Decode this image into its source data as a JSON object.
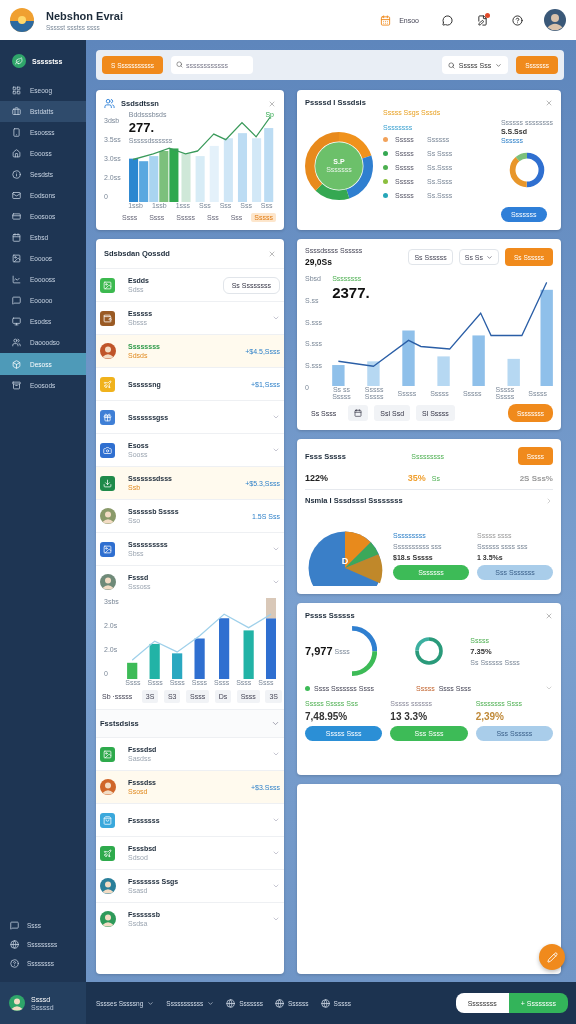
{
  "header": {
    "title": "Nebshon Evrai",
    "subtitle": "Ssssst ssstss ssss",
    "action": "Ensoo",
    "notification": true
  },
  "sidebar": {
    "brand": "Ssssstss",
    "items": [
      {
        "label": "Eseoog",
        "selected": false,
        "highlighted": false
      },
      {
        "label": "Bstdatts",
        "selected": false,
        "highlighted": true
      },
      {
        "label": "Esoosss",
        "selected": false,
        "highlighted": false
      },
      {
        "label": "Eoooss",
        "selected": false,
        "highlighted": false
      },
      {
        "label": "Sesdsts",
        "selected": false,
        "highlighted": false
      },
      {
        "label": "Eodsons",
        "selected": false,
        "highlighted": false
      },
      {
        "label": "Eoosoos",
        "selected": false,
        "highlighted": false
      },
      {
        "label": "Esbsd",
        "selected": false,
        "highlighted": false
      },
      {
        "label": "Eoooos",
        "selected": false,
        "highlighted": false
      },
      {
        "label": "Eooooss",
        "selected": false,
        "highlighted": false
      },
      {
        "label": "Eooooo",
        "selected": false,
        "highlighted": false
      },
      {
        "label": "Esodss",
        "selected": false,
        "highlighted": false
      },
      {
        "label": "Daooodso",
        "selected": false,
        "highlighted": false
      },
      {
        "label": "Desoss",
        "selected": true,
        "highlighted": false
      },
      {
        "label": "Eoosods",
        "selected": false,
        "highlighted": false
      }
    ],
    "footer_items": [
      "Ssss",
      "Sssssssss",
      "Ssssssss"
    ],
    "user": {
      "name": "Ssssd",
      "role": "Sssssd"
    }
  },
  "toolbar": {
    "primary_button": "S Sssssssssss",
    "search": {
      "placeholder": "ssssssssssss"
    },
    "filter": "Sssss Sss",
    "action_button": "Sssssss"
  },
  "summary_card": {
    "title": "Ssdsdtssn",
    "legend": "Bddsssbsds",
    "value": "277.",
    "caption": "Sssssdssssss",
    "badge": "Sp",
    "yticks": [
      "3dsb",
      "3.5ss",
      "3.0ss",
      "2.0ss",
      "0"
    ],
    "xlabels": [
      "1ssb",
      "1ssb",
      "1sss",
      "Sss",
      "Sss",
      "Sss",
      "Sss"
    ],
    "tags": [
      {
        "label": "Ssss",
        "selected": false
      },
      {
        "label": "Ssss",
        "selected": false
      },
      {
        "label": "Sssss",
        "selected": false
      },
      {
        "label": "Sss",
        "selected": false
      },
      {
        "label": "Sss",
        "selected": false
      },
      {
        "label": "Sssss",
        "selected": true
      }
    ]
  },
  "activity": {
    "title": "Sdsbsdan Qossdd",
    "rows": [
      {
        "kind": "tile",
        "color": "#3cb94f",
        "title": "Esdds",
        "subtitle": "Sdss",
        "button": "Ss Ssssssss",
        "highlighted": false
      },
      {
        "kind": "tile",
        "color": "#9a5a24",
        "title": "Esssss",
        "subtitle": "Sbsss",
        "highlighted": false
      },
      {
        "kind": "avatar",
        "color": "#c0552a",
        "title": "Ssssssss",
        "subtitle": "Sdsds",
        "amount": "+$4.5,Ssss",
        "highlighted": true
      },
      {
        "kind": "tile",
        "color": "#f0b21c",
        "title": "Ssssssng",
        "amount": "+$1,Ssss",
        "highlighted": false
      },
      {
        "kind": "tile",
        "color": "#3f7fd6",
        "title": "Sssssssgss",
        "highlighted": false
      },
      {
        "kind": "tile",
        "color": "#2f6fd0",
        "title": "Esoss",
        "subtitle": "Sooss",
        "highlighted": false
      },
      {
        "kind": "tile",
        "color": "#1f8a4a",
        "title": "Sssssssdsss",
        "subtitle": "Ssb",
        "amount": "+$5.3,Ssss",
        "highlighted": true
      },
      {
        "kind": "avatar",
        "color": "#8a9a6a",
        "title": "Ssssssb Sssss",
        "subtitle": "Sso",
        "amount": "1.5S Sss",
        "highlighted": false
      },
      {
        "kind": "tile",
        "color": "#2f6fd0",
        "title": "Ssssssssss",
        "subtitle": "Sbss",
        "highlighted": false
      },
      {
        "kind": "avatar",
        "color": "#6f8a78",
        "title": "Fsssd",
        "subtitle": "Sssoss",
        "highlighted": false
      }
    ],
    "chart": {
      "yticks": [
        "3sbs",
        "2.0s",
        "2.0s",
        "0"
      ],
      "xlabels": [
        "Ssss",
        "Ssss",
        "Ssss",
        "Ssss",
        "Ssss",
        "Ssss",
        "Ssss"
      ]
    },
    "filters": [
      {
        "label": "Sb ·sssss",
        "selected": false
      },
      {
        "label": "3S",
        "selected": true
      },
      {
        "label": "S3",
        "selected": true
      },
      {
        "label": "Ssss",
        "selected": true
      },
      {
        "label": "Ds",
        "selected": true
      },
      {
        "label": "Ssss",
        "selected": true
      },
      {
        "label": "3S",
        "selected": true
      }
    ]
  },
  "favorites": {
    "title": "Fsstsdsiss",
    "rows": [
      {
        "kind": "tile",
        "color": "#2eaa4c",
        "title": "Fsssdsd",
        "subtitle": "Sasdss",
        "highlighted": false
      },
      {
        "kind": "avatar",
        "color": "#d0662a",
        "title": "Fsssdss",
        "subtitle": "Ssosd",
        "amount": "+$3.Ssss",
        "highlighted": true
      },
      {
        "kind": "tile",
        "color": "#3aa8dc",
        "title": "Fsssssss",
        "highlighted": false
      },
      {
        "kind": "tile",
        "color": "#2eaa4c",
        "title": "Fsssbsd",
        "subtitle": "Sdsod",
        "highlighted": false
      },
      {
        "kind": "avatar",
        "color": "#2a7f9a",
        "title": "Fsssssss Ssgs",
        "subtitle": "Ssasd",
        "highlighted": false
      },
      {
        "kind": "avatar",
        "color": "#2e9a5a",
        "title": "Fssssssb",
        "subtitle": "Ssdsa",
        "highlighted": false
      }
    ]
  },
  "distribution": {
    "title": "Pssssd I Sssdsis",
    "center_value": "S.P",
    "center_label": "Sssssss",
    "heading": "Sssss Ssgs Sssds",
    "subheading": "Ssssssss",
    "legend": [
      {
        "label": "Sssss",
        "value": "Ssssss",
        "color": "#f2a25a"
      },
      {
        "label": "Sssss",
        "value": "Ss Ssss",
        "color": "#35a852"
      },
      {
        "label": "Sssss",
        "value": "Ss.Ssss",
        "color": "#4caf50"
      },
      {
        "label": "Sssss",
        "value": "Ss.Ssss",
        "color": "#8bbf3e"
      },
      {
        "label": "Sssss",
        "value": "Ss.Ssss",
        "color": "#26a6b8"
      }
    ],
    "side_label": "Ssssss ssssssss",
    "side_value": "S.S.Ssd",
    "side_link": "Ssssss",
    "button": "Sssssss"
  },
  "trend": {
    "title": "Ssssdssss Ssssss",
    "value": "29,0Ss",
    "select_1": "Ss Ssssss",
    "select_2": "Ss Ss",
    "button": "Ss Ssssss",
    "series_label": "Ssssssss",
    "big_value": "2377.",
    "yticks": [
      "Sbsd",
      "S.ss",
      "S.sss",
      "S.sss",
      "S.sss",
      "0"
    ],
    "xlabels": [
      "Ss ss Sssss",
      "Sssss Sssss",
      "Sssss",
      "Sssss",
      "Sssss",
      "Sssss Sssss",
      "Sssss"
    ],
    "footer": [
      "Ss Ssss",
      "Ssl Ssd",
      "Sl Sssss"
    ],
    "footer_button": "Ssssssss"
  },
  "rates": {
    "title": "Fsss Sssss",
    "status": "Sssssssss",
    "button": "Sssss",
    "stats": [
      {
        "value": "122%",
        "kind": "plain"
      },
      {
        "value": "35%",
        "kind": "accent",
        "note": "Ss"
      },
      {
        "value": "2S Sss%",
        "kind": "muted"
      }
    ],
    "section": "Nsmla I Sssdsssl Ssssssss",
    "pie_label": "D",
    "columns": [
      {
        "label": "Sssssssss",
        "caption": "Ssssssssss sss",
        "value": "$18.s Sssss",
        "button": "Sssssss",
        "kind": "primary"
      },
      {
        "label": "Sssss ssss",
        "caption": "Ssssss ssss sss",
        "value": "1 3.5%s",
        "button": "Sss Sssssss",
        "kind": "secondary"
      }
    ]
  },
  "progress": {
    "title": "Pssss Ssssss",
    "ring_value": "7,977",
    "ring_label": "Ssss",
    "side_label": "Sssss",
    "side_value": "7.35%",
    "side_caption": "Ss Ssssss Ssss",
    "row_left": "Ssss Sssssss Ssss",
    "row_right_1": "Sssss",
    "row_right_2": "Ssss Ssss",
    "stats": [
      {
        "label": "Sssss Sssss Sss",
        "value": "7,48.95%",
        "button": "Sssss Ssss",
        "kind": "blue"
      },
      {
        "label": "Sssss ssssss",
        "value": "13 3.3%",
        "button": "Sss Ssss",
        "kind": "green"
      },
      {
        "label": "Ssssssss Ssss",
        "value": "2,39%",
        "button": "Sss Ssssss",
        "kind": "light"
      }
    ]
  },
  "bottom_bar": {
    "items": [
      {
        "label": "Sssses Sssssng",
        "kind": "menu"
      },
      {
        "label": "Sssssssssss",
        "kind": "menu"
      },
      {
        "label": "Sssssss",
        "kind": "icon"
      },
      {
        "label": "Ssssss",
        "kind": "icon"
      },
      {
        "label": "Sssss",
        "kind": "icon"
      }
    ],
    "segments": [
      {
        "label": "Ssssssss",
        "selected": false
      },
      {
        "label": "+ Ssssssss",
        "selected": true
      }
    ]
  }
}
